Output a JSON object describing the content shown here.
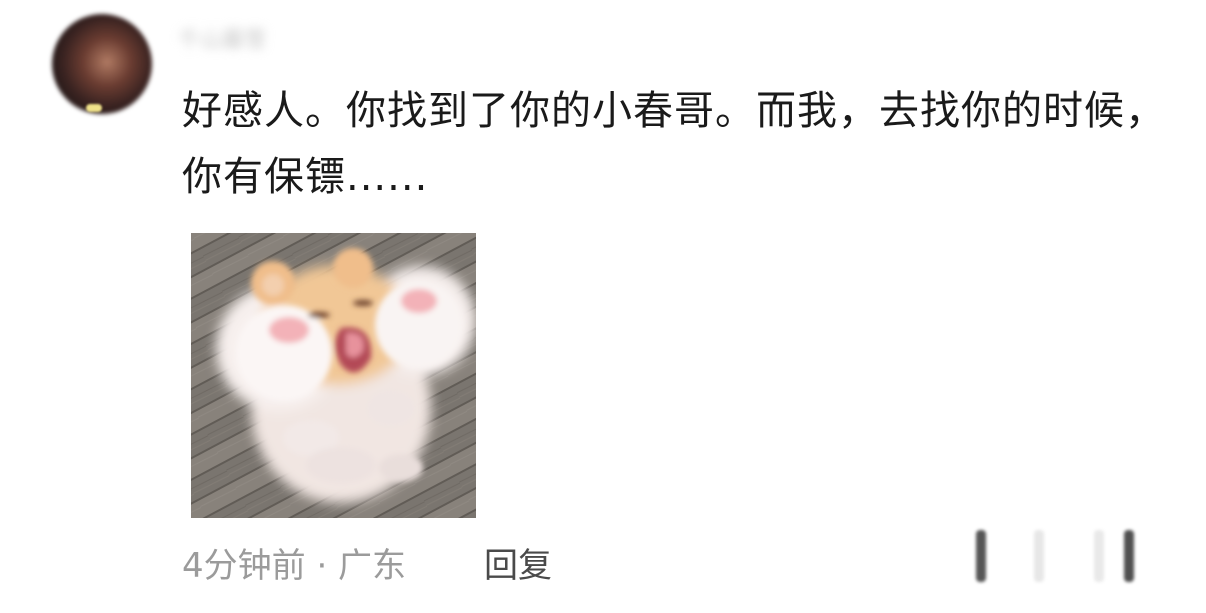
{
  "comment": {
    "username": "千山暮雪",
    "text": "好感人。你找到了你的小春哥。而我，去找你的时候，你有保镖......",
    "time_location": "4分钟前 · 广东",
    "reply_label": "回复"
  },
  "icons": {
    "sticker": "hamster-sticker-image",
    "avatar": "user-avatar"
  },
  "colors": {
    "meta_text": "#9b9b9b",
    "reply_text": "#4a4a4a",
    "body_text": "#1a1a1a"
  }
}
